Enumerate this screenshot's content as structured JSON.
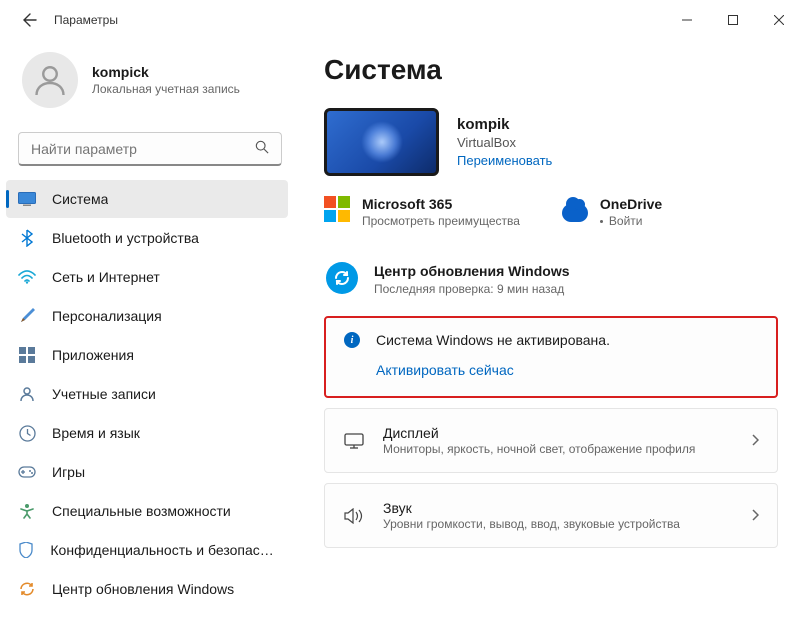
{
  "window": {
    "title": "Параметры"
  },
  "profile": {
    "name": "kompick",
    "sub": "Локальная учетная запись"
  },
  "search": {
    "placeholder": "Найти параметр"
  },
  "nav": {
    "items": [
      {
        "label": "Система"
      },
      {
        "label": "Bluetooth и устройства"
      },
      {
        "label": "Сеть и Интернет"
      },
      {
        "label": "Персонализация"
      },
      {
        "label": "Приложения"
      },
      {
        "label": "Учетные записи"
      },
      {
        "label": "Время и язык"
      },
      {
        "label": "Игры"
      },
      {
        "label": "Специальные возможности"
      },
      {
        "label": "Конфиденциальность и безопасность"
      },
      {
        "label": "Центр обновления Windows"
      }
    ]
  },
  "page": {
    "title": "Система"
  },
  "device": {
    "name": "kompik",
    "sub": "VirtualBox",
    "rename": "Переименовать"
  },
  "services": {
    "m365": {
      "title": "Microsoft 365",
      "sub": "Просмотреть преимущества"
    },
    "onedrive": {
      "title": "OneDrive",
      "sub": "Войти"
    }
  },
  "update": {
    "title": "Центр обновления Windows",
    "sub": "Последняя проверка: 9 мин назад"
  },
  "activation": {
    "msg": "Система Windows не активирована.",
    "link": "Активировать сейчас"
  },
  "settings": {
    "display": {
      "title": "Дисплей",
      "sub": "Мониторы, яркость, ночной свет, отображение профиля"
    },
    "sound": {
      "title": "Звук",
      "sub": "Уровни громкости, вывод, ввод, звуковые устройства"
    }
  }
}
